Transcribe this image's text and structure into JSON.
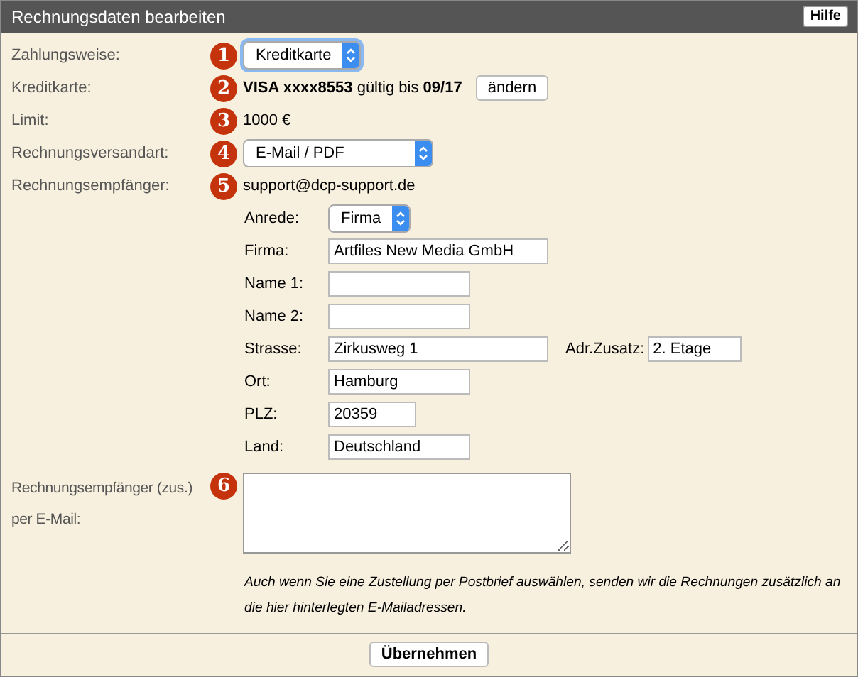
{
  "panel": {
    "title": "Rechnungsdaten bearbeiten",
    "help_button": "Hilfe"
  },
  "rows": [
    {
      "kind": "select",
      "label": "Zahlungsweise:",
      "badge": "1",
      "value": "Kreditkarte"
    },
    {
      "kind": "card",
      "label": "Kreditkarte:",
      "badge": "2",
      "value": "**VISA xxxx8553** gültig bis **09/17**",
      "button": "ändern"
    },
    {
      "kind": "text",
      "label": "Limit:",
      "badge": "3",
      "value": "1000 €"
    },
    {
      "kind": "select",
      "label": "Rechnungsversandart:",
      "badge": "4",
      "value": "E-Mail / PDF"
    },
    {
      "kind": "text",
      "label": "Rechnungsempfänger:",
      "badge": "5",
      "value": "support@dcp-support.de"
    }
  ],
  "recipient_fields": [
    {
      "kind": "select",
      "label": "Anrede:",
      "value": "Firma"
    },
    {
      "kind": "input",
      "label": "Firma:",
      "value": "Artfiles New Media GmbH"
    },
    {
      "kind": "input",
      "label": "Name 1:"
    },
    {
      "kind": "input",
      "label": "Name 2:"
    },
    {
      "kind": "input",
      "label": "Strasse:",
      "value": "Zirkusweg 1",
      "extra_label": "Adr.Zusatz:",
      "extra_value": "2. Etage"
    },
    {
      "kind": "input",
      "label": "Ort:",
      "value": "Hamburg"
    },
    {
      "kind": "input",
      "label": "PLZ:",
      "value": "20359"
    },
    {
      "kind": "input",
      "label": "Land:",
      "value": "Deutschland"
    }
  ],
  "extra_email": {
    "label": "Rechnungsempfänger (zus.) per E-Mail:",
    "badge": "6",
    "note": "Auch wenn Sie eine Zustellung per Postbrief auswählen, senden wir die Rechnungen zusätzlich an die hier hinterlegten E-Mailadressen."
  },
  "submit_button": "Übernehmen"
}
